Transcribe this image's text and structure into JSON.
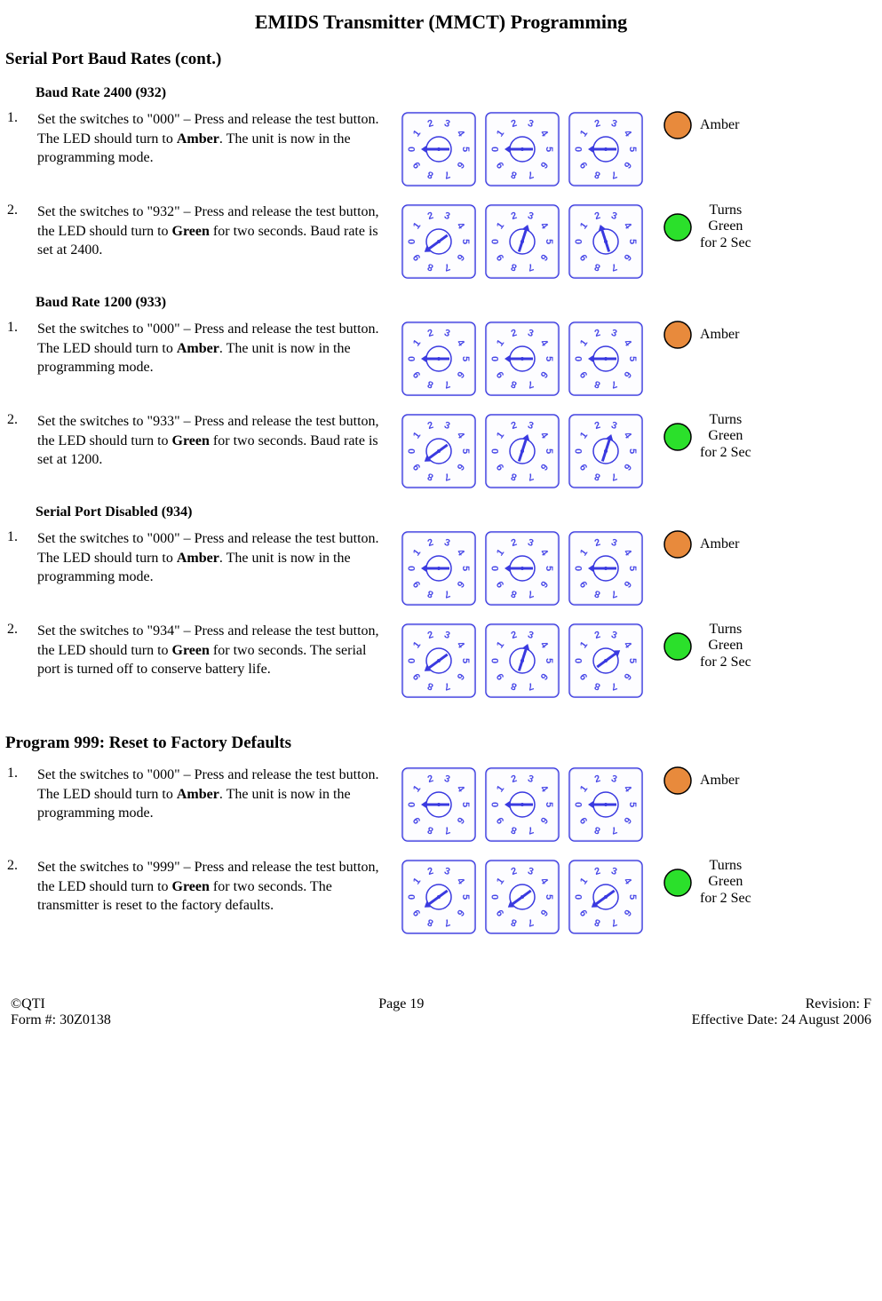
{
  "title": "EMIDS Transmitter (MMCT) Programming",
  "section1_heading": "Serial Port Baud Rates (cont.)",
  "section2_heading": "Program 999: Reset to Factory Defaults",
  "colors": {
    "amber": "#E88A3C",
    "green": "#2BE02B",
    "dial_outline": "#3A3AE0",
    "dial_text": "#4A4AE8"
  },
  "groups": [
    {
      "heading": "Baud Rate 2400 (932)",
      "steps": [
        {
          "num": "1.",
          "text_parts": [
            "Set the switches to \"000\" – Press and release the test button.  The LED should turn to ",
            "Amber",
            ". The unit is now in the programming mode."
          ],
          "dial_values": [
            0,
            0,
            0
          ],
          "led_color": "amber",
          "led_label": "Amber"
        },
        {
          "num": "2.",
          "text_parts": [
            "Set the switches to \"932\" – Press and release the test button, the LED should turn to ",
            "Green",
            " for two seconds.  Baud rate is set at 2400."
          ],
          "dial_values": [
            9,
            3,
            2
          ],
          "led_color": "green",
          "led_label": "Turns\nGreen\nfor 2 Sec"
        }
      ]
    },
    {
      "heading": "Baud Rate 1200 (933)",
      "steps": [
        {
          "num": "1.",
          "text_parts": [
            "Set the switches to \"000\" – Press and release the test button.  The LED should turn to ",
            "Amber",
            ". The unit is now in the programming mode."
          ],
          "dial_values": [
            0,
            0,
            0
          ],
          "led_color": "amber",
          "led_label": "Amber"
        },
        {
          "num": "2.",
          "text_parts": [
            "Set the switches to \"933\" – Press and release the test button, the LED should turn to ",
            "Green",
            " for two seconds.  Baud rate is set at 1200."
          ],
          "dial_values": [
            9,
            3,
            3
          ],
          "led_color": "green",
          "led_label": "Turns\nGreen\nfor 2 Sec"
        }
      ]
    },
    {
      "heading": "Serial Port Disabled (934)",
      "steps": [
        {
          "num": "1.",
          "text_parts": [
            "Set the switches to \"000\" – Press and release the test button.  The LED should turn to ",
            "Amber",
            ". The unit is now in the programming mode."
          ],
          "dial_values": [
            0,
            0,
            0
          ],
          "led_color": "amber",
          "led_label": "Amber"
        },
        {
          "num": "2.",
          "text_parts": [
            "Set the switches to \"934\" – Press and release the test button, the LED should turn to ",
            "Green",
            " for two seconds.  The serial port is turned off to conserve battery life."
          ],
          "dial_values": [
            9,
            3,
            4
          ],
          "led_color": "green",
          "led_label": "Turns\nGreen\nfor 2 Sec"
        }
      ]
    }
  ],
  "reset_steps": [
    {
      "num": "1.",
      "text_parts": [
        "Set the switches to \"000\" – Press and release the test button.  The LED should turn to ",
        "Amber",
        ". The unit is now in the programming mode."
      ],
      "dial_values": [
        0,
        0,
        0
      ],
      "led_color": "amber",
      "led_label": "Amber"
    },
    {
      "num": "2.",
      "text_parts": [
        "Set the switches to \"999\" – Press and release the test button, the LED should turn to ",
        "Green",
        " for two seconds.  The transmitter is reset to the factory defaults."
      ],
      "dial_values": [
        9,
        9,
        9
      ],
      "led_color": "green",
      "led_label": "Turns\nGreen\nfor 2 Sec"
    }
  ],
  "footer": {
    "left": "©QTI\nForm #: 30Z0138",
    "center": "Page  19",
    "right": "Revision: F\nEffective Date: 24 August 2006"
  }
}
